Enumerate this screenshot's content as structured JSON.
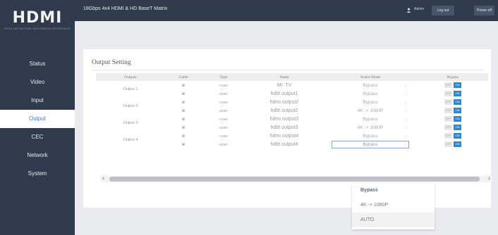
{
  "logo": {
    "text": "HDMI",
    "tagline": "HIGH-DEFINITION MULTIMEDIA INTERFACE"
  },
  "header": {
    "title": "18Gbps 4x4 HDMI & HD BaseT Matrix",
    "user": "Admin",
    "logout_label": "Log out",
    "power_label": "Power off"
  },
  "sidebar": {
    "items": [
      {
        "label": "Status"
      },
      {
        "label": "Video"
      },
      {
        "label": "Input"
      },
      {
        "label": "Output",
        "active": true
      },
      {
        "label": "CEC"
      },
      {
        "label": "Network"
      },
      {
        "label": "System"
      }
    ]
  },
  "output_setting": {
    "title": "Output Setting",
    "columns": [
      "Outputs",
      "Cable",
      "Type",
      "Name",
      "Scaler Mode",
      "Bypass"
    ],
    "bypass_off_label": "OFF",
    "bypass_on_label": "ON",
    "groups": [
      {
        "output": "Output 1",
        "rows": [
          {
            "cable": "※",
            "type": "HDMI",
            "name": "MI. TV",
            "scaler": "Bypass"
          },
          {
            "cable": "※",
            "type": "HDBT",
            "name": "hdbt output1",
            "scaler": "Bypass"
          }
        ]
      },
      {
        "output": "Output 2",
        "rows": [
          {
            "cable": "※",
            "type": "HDMI",
            "name": "hdmi output2",
            "scaler": "Bypass"
          },
          {
            "cable": "※",
            "type": "HDBT",
            "name": "hdbt output2",
            "scaler": "4K -> 1080P"
          }
        ]
      },
      {
        "output": "Output 3",
        "rows": [
          {
            "cable": "※",
            "type": "HDMI",
            "name": "hdmi output3",
            "scaler": "Bypass"
          },
          {
            "cable": "※",
            "type": "HDBT",
            "name": "hdbt output3",
            "scaler": "4K -> 1080P"
          }
        ]
      },
      {
        "output": "Output 4",
        "rows": [
          {
            "cable": "※",
            "type": "HDMI",
            "name": "hdmi output4",
            "scaler": "Bypass"
          },
          {
            "cable": "※",
            "type": "HDBT",
            "name": "hdbt output4",
            "scaler": "Bypass"
          }
        ]
      }
    ]
  },
  "dropdown": {
    "options": [
      "Bypass",
      "4K -> 1080P",
      "AUTO"
    ],
    "selected": "Bypass"
  },
  "colors": {
    "sidebar_bg": "#2f3b4c",
    "accent": "#2f86c9",
    "active_nav_text": "#3a7bd0"
  }
}
